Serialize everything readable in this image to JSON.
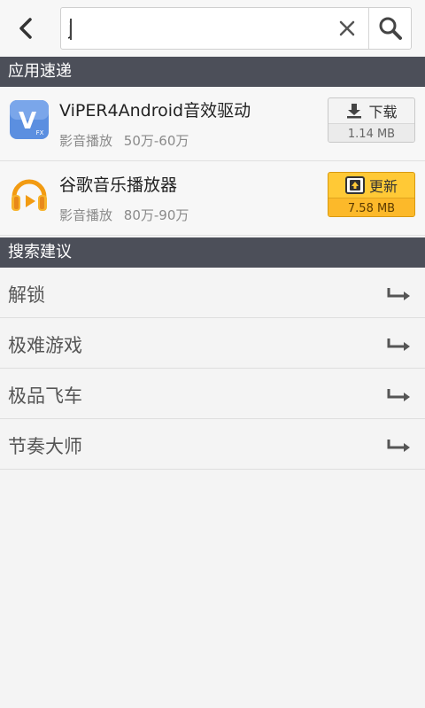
{
  "search": {
    "value": "j",
    "placeholder": ""
  },
  "sections": {
    "apps_title": "应用速递",
    "suggest_title": "搜索建议"
  },
  "apps": [
    {
      "name": "ViPER4Android音效驱动",
      "category": "影音播放",
      "downloads": "50万-60万",
      "action_label": "下载",
      "size": "1.14 MB",
      "icon": "viper-fx-icon",
      "action_icon": "download-icon",
      "accent": "#5b8fe0"
    },
    {
      "name": "谷歌音乐播放器",
      "category": "影音播放",
      "downloads": "80万-90万",
      "action_label": "更新",
      "size": "7.58 MB",
      "icon": "google-play-music-icon",
      "action_icon": "update-icon",
      "accent": "#f7a81b"
    }
  ],
  "suggestions": [
    {
      "label": "解锁"
    },
    {
      "label": "极难游戏"
    },
    {
      "label": "极品飞车"
    },
    {
      "label": "节奏大师"
    }
  ],
  "colors": {
    "section_header_bg": "#4c4f59",
    "update_button": "#ffc936",
    "page_bg": "#f4f4f4"
  }
}
